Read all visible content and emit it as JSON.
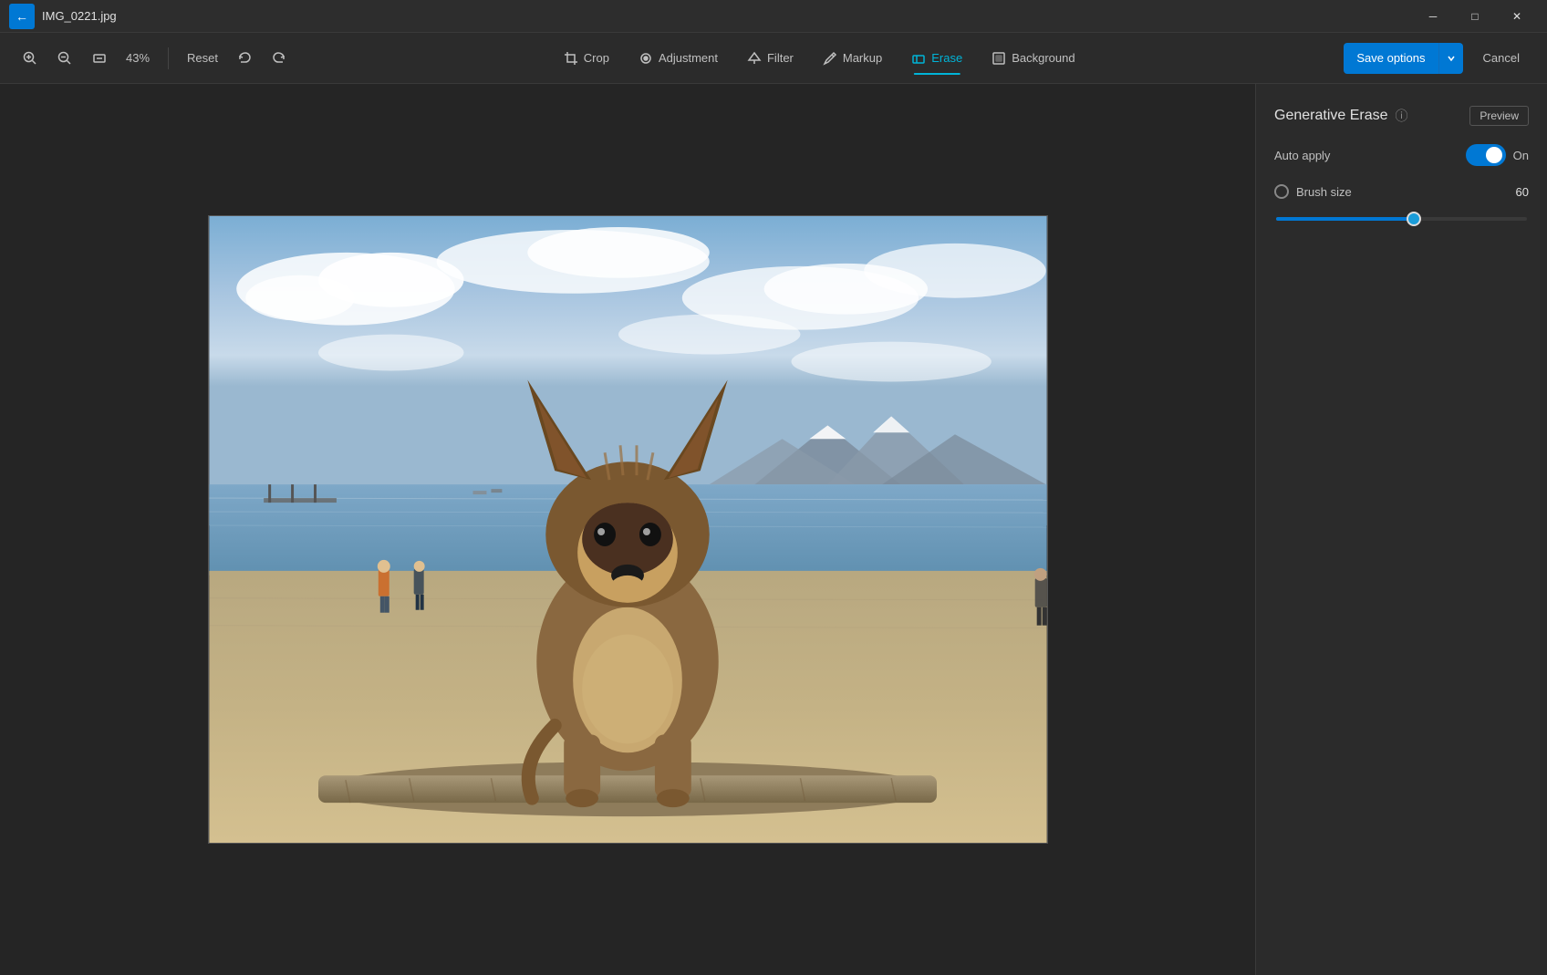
{
  "titlebar": {
    "filename": "IMG_0221.jpg",
    "back_icon": "←",
    "minimize_icon": "─",
    "maximize_icon": "□",
    "close_icon": "✕"
  },
  "toolbar": {
    "zoom_in_icon": "🔍+",
    "zoom_out_icon": "🔍−",
    "fit_icon": "⊡",
    "zoom_level": "43%",
    "reset_label": "Reset",
    "undo_icon": "↩",
    "redo_icon": "↪",
    "tools": [
      {
        "id": "crop",
        "label": "Crop",
        "icon": "⊡"
      },
      {
        "id": "adjustment",
        "label": "Adjustment",
        "icon": "◈"
      },
      {
        "id": "filter",
        "label": "Filter",
        "icon": "▦"
      },
      {
        "id": "markup",
        "label": "Markup",
        "icon": "✏"
      },
      {
        "id": "erase",
        "label": "Erase",
        "icon": "◻",
        "active": true
      },
      {
        "id": "background",
        "label": "Background",
        "icon": "⬚"
      }
    ],
    "save_options_label": "Save options",
    "cancel_label": "Cancel",
    "chevron_icon": "▾"
  },
  "panel": {
    "title": "Generative Erase",
    "info_icon": "ⓘ",
    "preview_label": "Preview",
    "auto_apply_label": "Auto apply",
    "toggle_state": "On",
    "brush_size_label": "Brush size",
    "brush_size_value": "60",
    "slider_min": 0,
    "slider_max": 100,
    "slider_value": 60
  },
  "colors": {
    "accent": "#0078d4",
    "active_tool": "#00b4d8",
    "bg_dark": "#1e1e1e",
    "bg_panel": "#2b2b2b",
    "bg_titlebar": "#2d2d2d"
  }
}
